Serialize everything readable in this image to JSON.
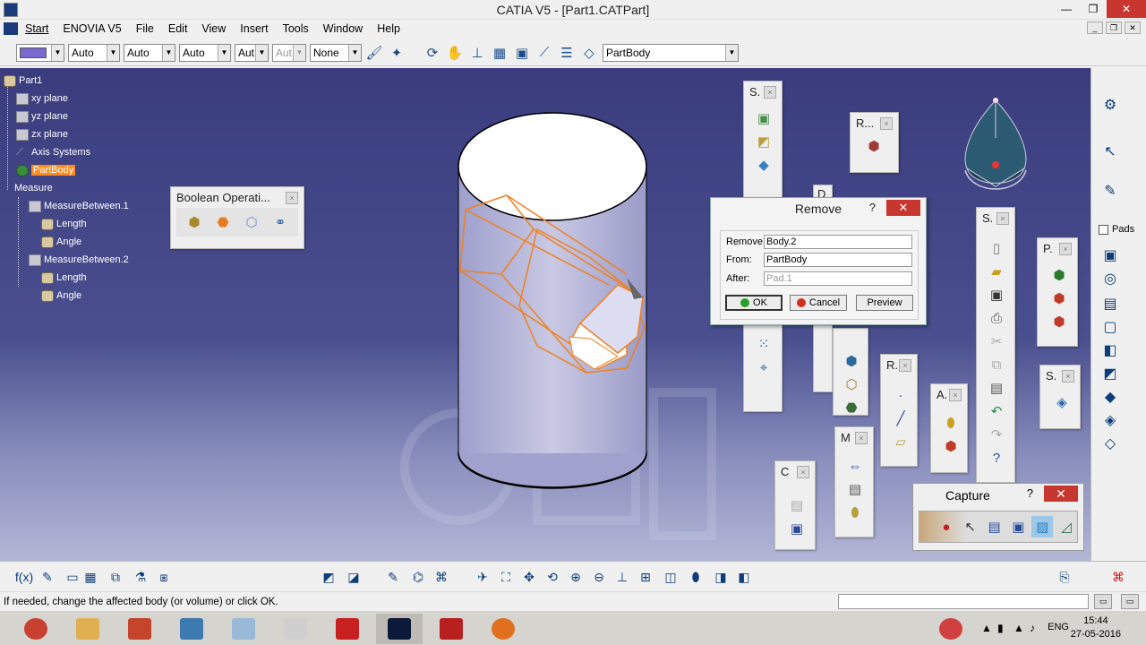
{
  "window": {
    "title": "CATIA V5 - [Part1.CATPart]",
    "min": "—",
    "max": "❐",
    "close": "✕"
  },
  "menu": {
    "items": [
      "Start",
      "ENOVIA V5",
      "File",
      "Edit",
      "View",
      "Insert",
      "Tools",
      "Window",
      "Help"
    ]
  },
  "toolbar": {
    "dropdowns": [
      "Auto",
      "Auto",
      "Auto",
      "Aut",
      "Aut",
      "None"
    ],
    "body_select": "PartBody"
  },
  "tree": {
    "root": "Part1",
    "items": [
      "xy plane",
      "yz plane",
      "zx plane",
      "Axis Systems",
      "PartBody",
      "Measure",
      "MeasureBetween.1",
      "Length",
      "Angle",
      "MeasureBetween.2",
      "Length",
      "Angle"
    ]
  },
  "palettes": {
    "boolean": "Boolean Operati...",
    "s1": "S.",
    "r1": "R...",
    "d1": "D",
    "s2": "S.",
    "p1": "P.",
    "s3": "S.",
    "r2": "R.",
    "a1": "A.",
    "m1": "M",
    "c1": "C"
  },
  "remove_dialog": {
    "title": "Remove",
    "help": "?",
    "close": "✕",
    "remove_label": "Remove",
    "remove_value": "Body.2",
    "from_label": "From:",
    "from_value": "PartBody",
    "after_label": "After:",
    "after_value": "Pad.1",
    "ok": "OK",
    "cancel": "Cancel",
    "preview": "Preview"
  },
  "capture": {
    "title": "Capture",
    "help": "?",
    "close": "✕"
  },
  "right_toolbar": {
    "pads_label": "Pads"
  },
  "status": {
    "message": "If needed, change the affected body (or volume) or click OK."
  },
  "taskbar": {
    "lang": "ENG",
    "time": "15:44",
    "date": "27-05-2016"
  },
  "colors": {
    "selection": "#ff8a1e",
    "close_red": "#c7372f",
    "viewport_top": "#3a3c7e"
  }
}
